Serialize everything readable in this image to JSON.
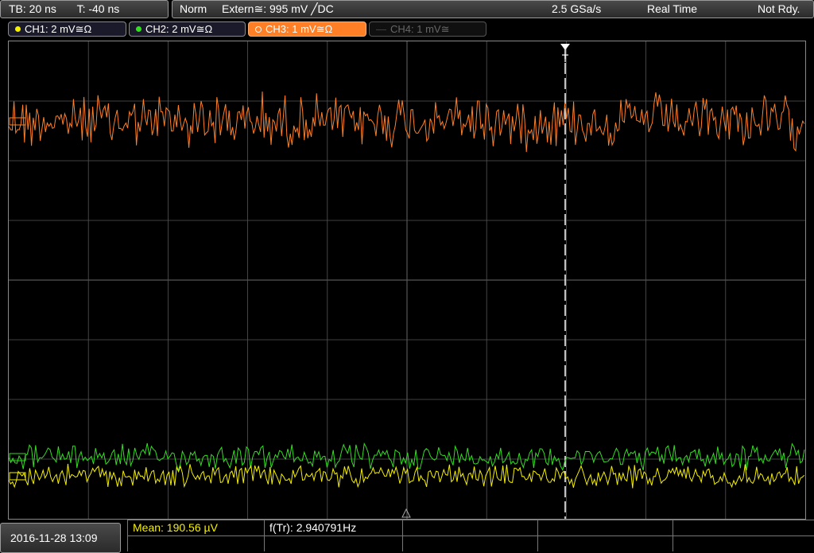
{
  "header": {
    "timebase": "TB: 20 ns",
    "trigger_time": "T: -40 ns",
    "mode": "Norm",
    "trigger_source": "Extern≅: 995 mV ╱DC",
    "sample_rate": "2.5 GSa/s",
    "acquisition": "Real Time",
    "status": "Not Rdy."
  },
  "channels": [
    {
      "label": "CH1: 2 mV≅Ω",
      "color": "#f5f000",
      "active": true
    },
    {
      "label": "CH2: 2 mV≅Ω",
      "color": "#33dd22",
      "active": true
    },
    {
      "label": "CH3: 1 mV≅Ω",
      "color": "#ff7f27",
      "active": true,
      "selected": true
    },
    {
      "label": "CH4: 1 mV≅",
      "color": "#555555",
      "active": false
    }
  ],
  "markers": {
    "trigger": "T"
  },
  "colors": {
    "ch1": "#f5f000",
    "ch2": "#33dd22",
    "ch3": "#ff7f27",
    "grid": "#666666"
  },
  "measurements": {
    "mean": "Mean: 190.56 µV",
    "freq": "f(Tr): 2.940791Hz"
  },
  "footer": {
    "datetime": "2016-11-28 13:09"
  }
}
